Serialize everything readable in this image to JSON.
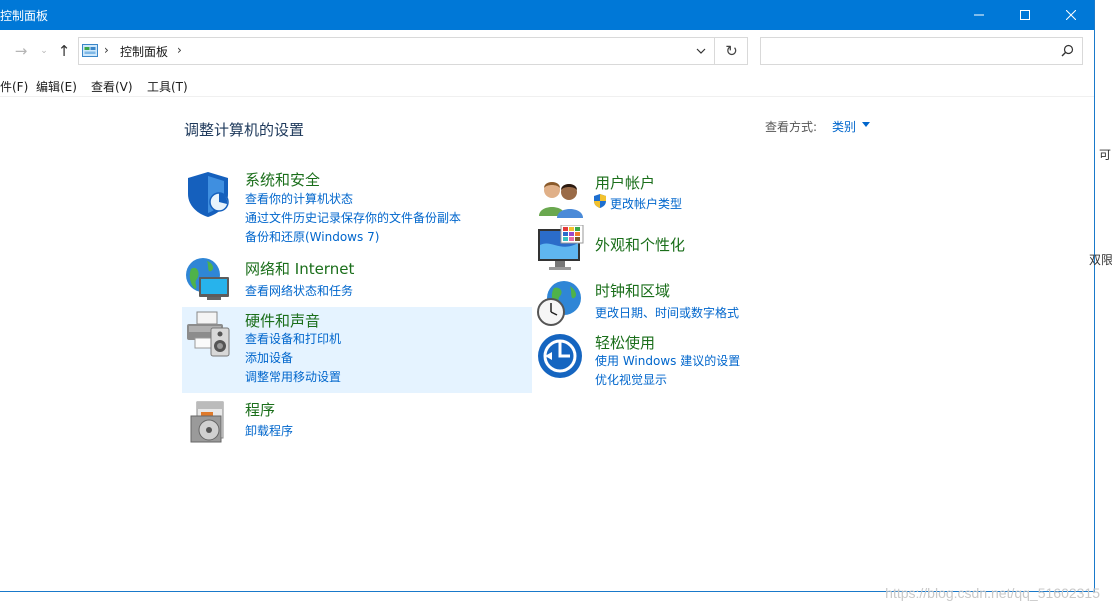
{
  "window": {
    "title": "控制面板"
  },
  "address": {
    "root_label": "控制面板",
    "separator": "›"
  },
  "search": {
    "placeholder": "",
    "value": ""
  },
  "menu": {
    "items": [
      "件(F)",
      "编辑(E)",
      "查看(V)",
      "工具(T)"
    ]
  },
  "main": {
    "heading": "调整计算机的设置",
    "view_by_label": "查看方式:",
    "view_by_value": "类别"
  },
  "categories": {
    "system": {
      "title": "系统和安全",
      "links": [
        "查看你的计算机状态",
        "通过文件历史记录保存你的文件备份副本",
        "备份和还原(Windows 7)"
      ],
      "icon": "shield-icon"
    },
    "network": {
      "title": "网络和 Internet",
      "links": [
        "查看网络状态和任务"
      ],
      "icon": "network-globe-icon"
    },
    "hardware": {
      "title": "硬件和声音",
      "links": [
        "查看设备和打印机",
        "添加设备",
        "调整常用移动设置"
      ],
      "icon": "printer-icon"
    },
    "programs": {
      "title": "程序",
      "links": [
        "卸载程序"
      ],
      "icon": "programs-icon"
    },
    "user": {
      "title": "用户帐户",
      "links": [
        "更改帐户类型"
      ],
      "icon": "users-icon"
    },
    "appearance": {
      "title": "外观和个性化",
      "links": [],
      "icon": "monitor-palette-icon"
    },
    "clock": {
      "title": "时钟和区域",
      "links": [
        "更改日期、时间或数字格式"
      ],
      "icon": "clock-globe-icon"
    },
    "ease": {
      "title": "轻松使用",
      "links": [
        "使用 Windows 建议的设置",
        "优化视觉显示"
      ],
      "icon": "ease-of-access-icon"
    }
  },
  "outside": {
    "fragment_1": "可",
    "fragment_2": "双限"
  },
  "watermark": "https://blog.csdn.net/qq_51602315",
  "colors": {
    "titlebar": "#0078d7",
    "link": "#0066cc",
    "category_title": "#1a6e1a",
    "highlight": "#e5f3ff"
  }
}
